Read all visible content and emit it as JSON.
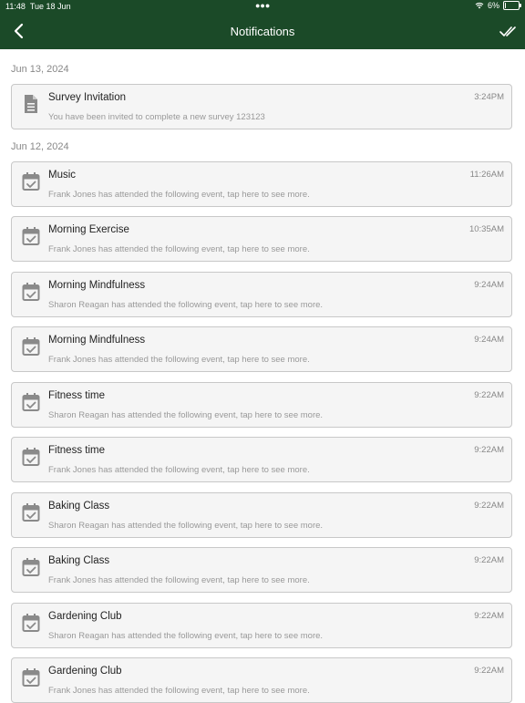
{
  "status_bar": {
    "time": "11:48",
    "date": "Tue 18 Jun",
    "battery": "6%",
    "battery_level": 0.06
  },
  "header": {
    "title": "Notifications"
  },
  "groups": [
    {
      "date": "Jun 13, 2024",
      "items": [
        {
          "icon": "document-icon",
          "title": "Survey Invitation",
          "time": "3:24PM",
          "message": "You have been invited to complete a new survey 123123"
        }
      ]
    },
    {
      "date": "Jun 12, 2024",
      "items": [
        {
          "icon": "calendar-check-icon",
          "title": "Music",
          "time": "11:26AM",
          "message": "Frank Jones has attended the following event, tap here to see more."
        },
        {
          "icon": "calendar-check-icon",
          "title": "Morning Exercise",
          "time": "10:35AM",
          "message": "Frank Jones has attended the following event, tap here to see more."
        },
        {
          "icon": "calendar-check-icon",
          "title": "Morning Mindfulness",
          "time": "9:24AM",
          "message": "Sharon Reagan has attended the following event, tap here to see more."
        },
        {
          "icon": "calendar-check-icon",
          "title": "Morning Mindfulness",
          "time": "9:24AM",
          "message": "Frank Jones has attended the following event, tap here to see more."
        },
        {
          "icon": "calendar-check-icon",
          "title": "Fitness time",
          "time": "9:22AM",
          "message": "Sharon Reagan has attended the following event, tap here to see more."
        },
        {
          "icon": "calendar-check-icon",
          "title": "Fitness time",
          "time": "9:22AM",
          "message": "Frank Jones has attended the following event, tap here to see more."
        },
        {
          "icon": "calendar-check-icon",
          "title": "Baking Class",
          "time": "9:22AM",
          "message": "Sharon Reagan has attended the following event, tap here to see more."
        },
        {
          "icon": "calendar-check-icon",
          "title": "Baking Class",
          "time": "9:22AM",
          "message": "Frank Jones has attended the following event, tap here to see more."
        },
        {
          "icon": "calendar-check-icon",
          "title": "Gardening Club",
          "time": "9:22AM",
          "message": "Sharon Reagan has attended the following event, tap here to see more."
        },
        {
          "icon": "calendar-check-icon",
          "title": "Gardening Club",
          "time": "9:22AM",
          "message": "Frank Jones has attended the following event, tap here to see more."
        }
      ]
    }
  ],
  "colors": {
    "header_bg": "#1b4a28",
    "card_bg": "#f5f5f5",
    "card_border": "#c8c8c8",
    "icon": "#8a8a8a"
  }
}
